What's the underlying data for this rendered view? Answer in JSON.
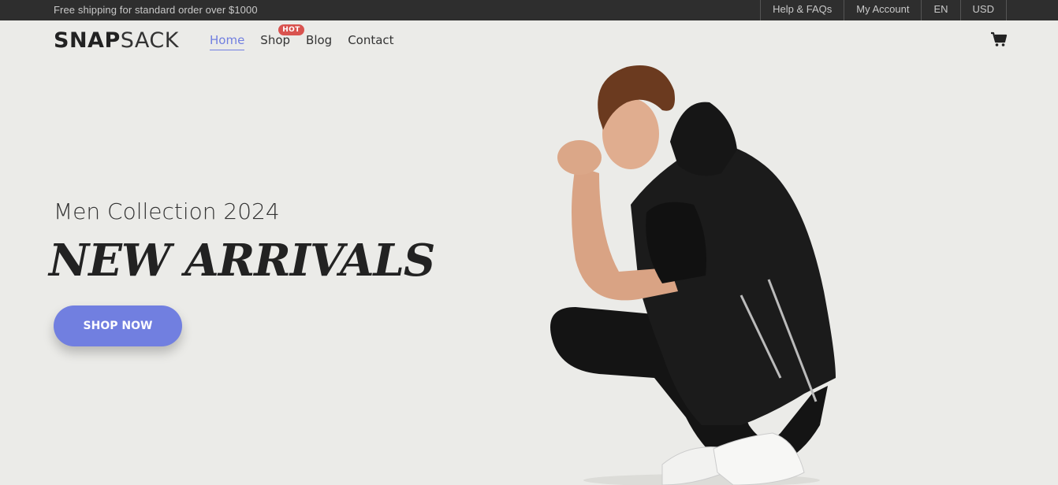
{
  "topbar": {
    "promo": "Free shipping for standard order over $1000",
    "links": [
      "Help & FAQs",
      "My Account",
      "EN",
      "USD"
    ]
  },
  "header": {
    "logo_bold": "SNAP",
    "logo_light": "SACK",
    "nav": [
      {
        "label": "Home",
        "active": true
      },
      {
        "label": "Shop",
        "badge": "HOT"
      },
      {
        "label": "Blog"
      },
      {
        "label": "Contact"
      }
    ],
    "cart_icon": "cart-icon"
  },
  "hero": {
    "subtitle": "Men Collection 2024",
    "title": "NEW ARRIVALS",
    "button_label": "SHOP NOW",
    "image": "model-photo"
  },
  "colors": {
    "accent": "#717fe0",
    "badge": "#d9534f",
    "topbar_bg": "#2e2e2e",
    "page_bg": "#ebebe8"
  }
}
